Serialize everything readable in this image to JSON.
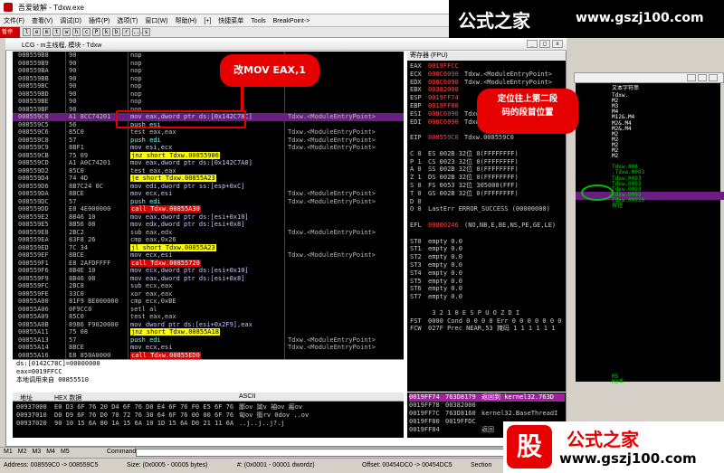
{
  "window": {
    "title": "吾爱破解 - Tdxw.exe"
  },
  "menu": [
    "文件(F)",
    "查看(V)",
    "调试(D)",
    "插件(P)",
    "选项(T)",
    "窗口(W)",
    "帮助(H)",
    "[+]",
    "快捷菜单",
    "Tools",
    "BreakPoint->"
  ],
  "toolbar": {
    "state": "暂停",
    "letters": [
      "l",
      "e",
      "m",
      "t",
      "w",
      "h",
      "c",
      "P",
      "k",
      "b",
      "r",
      "...",
      "s"
    ]
  },
  "brand": {
    "top_name": "公式之家",
    "top_url": "www.gszj100.com",
    "bottom_logo": "股",
    "bottom_name": "公式之家",
    "bottom_url": "www.gszj100.com"
  },
  "cpu": {
    "title": "LCG - m主线程, 模块 - Tdxw",
    "disasm": [
      {
        "addr": "008559B8",
        "hex": "90",
        "asm": "nop",
        "cmt": ""
      },
      {
        "addr": "008559B9",
        "hex": "90",
        "asm": "nop",
        "cmt": ""
      },
      {
        "addr": "008559BA",
        "hex": "90",
        "asm": "nop",
        "cmt": ""
      },
      {
        "addr": "008559BB",
        "hex": "90",
        "asm": "nop",
        "cmt": ""
      },
      {
        "addr": "008559BC",
        "hex": "90",
        "asm": "nop",
        "cmt": ""
      },
      {
        "addr": "008559BD",
        "hex": "90",
        "asm": "nop",
        "cmt": ""
      },
      {
        "addr": "008559BE",
        "hex": "90",
        "asm": "nop",
        "cmt": ""
      },
      {
        "addr": "008559BF",
        "hex": "90",
        "asm": "nop",
        "cmt": ""
      },
      {
        "addr": "008559C0",
        "hex": "A1 8CC74201",
        "asm": "mov eax,dword ptr ds:[0x142C78C]",
        "cmt": "Tdxw.<ModuleEntryPoint>"
      },
      {
        "addr": "008559C5",
        "hex": "56",
        "asm": "push esi",
        "cmt": ""
      },
      {
        "addr": "008559C6",
        "hex": "85C0",
        "asm": "test eax,eax",
        "cmt": "Tdxw.<ModuleEntryPoint>"
      },
      {
        "addr": "008559C8",
        "hex": "57",
        "asm": "push edi",
        "cmt": "Tdxw.<ModuleEntryPoint>"
      },
      {
        "addr": "008559C9",
        "hex": "8BF1",
        "asm": "mov esi,ecx",
        "cmt": "Tdxw.<ModuleEntryPoint>"
      },
      {
        "addr": "008559CB",
        "hex": "75 09",
        "asm": "jnz short Tdxw.00855906",
        "cmt": ""
      },
      {
        "addr": "008559CD",
        "hex": "A1 A0C74201",
        "asm": "mov eax,dword ptr ds:[0x142C7A0]",
        "cmt": ""
      },
      {
        "addr": "008559D2",
        "hex": "85C0",
        "asm": "test eax,eax",
        "cmt": ""
      },
      {
        "addr": "008559D4",
        "hex": "74 4D",
        "asm": "je short Tdxw.00855A23",
        "cmt": ""
      },
      {
        "addr": "008559D6",
        "hex": "8B7C24 0C",
        "asm": "mov edi,dword ptr ss:[esp+0xC]",
        "cmt": ""
      },
      {
        "addr": "008559DA",
        "hex": "8BCE",
        "asm": "mov ecx,esi",
        "cmt": "Tdxw.<ModuleEntryPoint>"
      },
      {
        "addr": "008559DC",
        "hex": "57",
        "asm": "push edi",
        "cmt": "Tdxw.<ModuleEntryPoint>"
      },
      {
        "addr": "008559DD",
        "hex": "E8 4E000000",
        "asm": "call Tdxw.00855A30",
        "cmt": ""
      },
      {
        "addr": "008559E2",
        "hex": "8B46 10",
        "asm": "mov eax,dword ptr ds:[esi+0x10]",
        "cmt": ""
      },
      {
        "addr": "008559E5",
        "hex": "8B56 08",
        "asm": "mov edx,dword ptr ds:[esi+0x8]",
        "cmt": ""
      },
      {
        "addr": "008559E8",
        "hex": "2BC2",
        "asm": "sub eax,edx",
        "cmt": "Tdxw.<ModuleEntryPoint>"
      },
      {
        "addr": "008559EA",
        "hex": "83F8 26",
        "asm": "cmp eax,0x26",
        "cmt": ""
      },
      {
        "addr": "008559ED",
        "hex": "7C 34",
        "asm": "jl short Tdxw.00855A23",
        "cmt": ""
      },
      {
        "addr": "008559EF",
        "hex": "8BCE",
        "asm": "mov ecx,esi",
        "cmt": "Tdxw.<ModuleEntryPoint>"
      },
      {
        "addr": "008559F1",
        "hex": "E8 2AFDFFFF",
        "asm": "call Tdxw.00855720",
        "cmt": ""
      },
      {
        "addr": "008559F6",
        "hex": "8B4E 10",
        "asm": "mov ecx,dword ptr ds:[esi+0x10]",
        "cmt": ""
      },
      {
        "addr": "008559F9",
        "hex": "8B46 08",
        "asm": "mov eax,dword ptr ds:[esi+0x8]",
        "cmt": ""
      },
      {
        "addr": "008559FC",
        "hex": "2BC8",
        "asm": "sub ecx,eax",
        "cmt": ""
      },
      {
        "addr": "008559FE",
        "hex": "33C0",
        "asm": "xor eax,eax",
        "cmt": ""
      },
      {
        "addr": "00855A00",
        "hex": "81F9 BE000000",
        "asm": "cmp ecx,0xBE",
        "cmt": ""
      },
      {
        "addr": "00855A06",
        "hex": "0F9CC0",
        "asm": "setl al",
        "cmt": ""
      },
      {
        "addr": "00855A09",
        "hex": "85C0",
        "asm": "test eax,eax",
        "cmt": ""
      },
      {
        "addr": "00855A0B",
        "hex": "8986 F9020000",
        "asm": "mov dword ptr ds:[esi+0x2F9],eax",
        "cmt": ""
      },
      {
        "addr": "00855A11",
        "hex": "75 08",
        "asm": "jnz short Tdxw.00855A18",
        "cmt": ""
      },
      {
        "addr": "00855A13",
        "hex": "57",
        "asm": "push edi",
        "cmt": "Tdxw.<ModuleEntryPoint>"
      },
      {
        "addr": "00855A14",
        "hex": "8BCE",
        "asm": "mov ecx,esi",
        "cmt": "Tdxw.<ModuleEntryPoint>"
      },
      {
        "addr": "00855A16",
        "hex": "E8 850A0000",
        "asm": "call Tdxw.00855ED0",
        "cmt": ""
      }
    ],
    "info": [
      "ds:[0142C78C]=00000000",
      "eax=0019FFCC",
      "本地调用来自 00855510"
    ],
    "dump": {
      "headers": [
        "地址",
        "HEX 数据",
        "ASCII"
      ],
      "rows": [
        {
          "addr": "00937000",
          "hex": "E0 D3 6F 76 20 D4 6F 76 D0 E4 6F 76 F0 E5 6F 76",
          "ascii": "鄙ov 詏v 袖ov 瘢ov"
        },
        {
          "addr": "00937010",
          "hex": "D0 D9 6F 76 D0 70 72 76 30 64 6F 76 00 00 6F 76",
          "ascii": "匈ov 衟rv 0dov ..ov"
        },
        {
          "addr": "00937020",
          "hex": "90 10 15 6A 80 1A 15 6A 10 1D 15 6A D0 21 11 6A",
          "ascii": "..j..j..j?.j"
        }
      ]
    }
  },
  "registers": {
    "title": "寄存器 (FPU)",
    "rows": [
      {
        "name": "EAX",
        "val": "0019FFCC",
        "note": ""
      },
      {
        "name": "ECX",
        "val": "008C6090",
        "note": "Tdxw.<ModuleEntryPoint>"
      },
      {
        "name": "EDX",
        "val": "008C6090",
        "note": "Tdxw.<ModuleEntryPoint>"
      },
      {
        "name": "EBX",
        "val": "00382000",
        "note": ""
      },
      {
        "name": "ESP",
        "val": "0019FF74",
        "note": ""
      },
      {
        "name": "EBP",
        "val": "0019FF80",
        "note": ""
      },
      {
        "name": "ESI",
        "val": "008C6090",
        "note": "Tdxw.<ModuleEntryPoint>"
      },
      {
        "name": "EDI",
        "val": "008C6090",
        "note": "Tdxw.<ModuleEntryPoint>"
      },
      {
        "name": "",
        "val": "",
        "note": ""
      },
      {
        "name": "EIP",
        "val": "008559C0",
        "note": "Tdxw.008559C0"
      },
      {
        "name": "",
        "val": "",
        "note": ""
      },
      {
        "name": "C 0",
        "val": "",
        "note": "ES 002B 32位 0(FFFFFFFF)"
      },
      {
        "name": "P 1",
        "val": "",
        "note": "CS 0023 32位 0(FFFFFFFF)"
      },
      {
        "name": "A 0",
        "val": "",
        "note": "SS 002B 32位 0(FFFFFFFF)"
      },
      {
        "name": "Z 1",
        "val": "",
        "note": "DS 002B 32位 0(FFFFFFFF)"
      },
      {
        "name": "S 0",
        "val": "",
        "note": "FS 0053 32位 305000(FFF)"
      },
      {
        "name": "T 0",
        "val": "",
        "note": "GS 002B 32位 0(FFFFFFFF)"
      },
      {
        "name": "D 0",
        "val": "",
        "note": ""
      },
      {
        "name": "O 0",
        "val": "",
        "note": "LastErr ERROR_SUCCESS (00000000)"
      },
      {
        "name": "",
        "val": "",
        "note": ""
      },
      {
        "name": "EFL",
        "val": "00000246",
        "note": "(NO,NB,E,BE,NS,PE,GE,LE)"
      },
      {
        "name": "",
        "val": "",
        "note": ""
      },
      {
        "name": "ST0",
        "val": "",
        "note": "empty 0.0"
      },
      {
        "name": "ST1",
        "val": "",
        "note": "empty 0.0"
      },
      {
        "name": "ST2",
        "val": "",
        "note": "empty 0.0"
      },
      {
        "name": "ST3",
        "val": "",
        "note": "empty 0.0"
      },
      {
        "name": "ST4",
        "val": "",
        "note": "empty 0.0"
      },
      {
        "name": "ST5",
        "val": "",
        "note": "empty 0.0"
      },
      {
        "name": "ST6",
        "val": "",
        "note": "empty 0.0"
      },
      {
        "name": "ST7",
        "val": "",
        "note": "empty 0.0"
      },
      {
        "name": "",
        "val": "",
        "note": ""
      },
      {
        "name": "",
        "val": "",
        "note": "               3 2 1 0     E S P U O Z D I"
      },
      {
        "name": "FST",
        "val": "",
        "note": "0000  Cond 0 0 0 0  Err 0 0 0 0 0 0 0 0"
      },
      {
        "name": "FCW",
        "val": "",
        "note": "027F  Prec NEAR,53  掩码  1 1 1 1 1 1"
      }
    ]
  },
  "stack": [
    {
      "addr": "0019FF74",
      "val": "763D8179",
      "cmt": "返回到 kernel32.763D"
    },
    {
      "addr": "0019FF78",
      "val": "00382000",
      "cmt": ""
    },
    {
      "addr": "0019FF7C",
      "val": "763D8160",
      "cmt": "kernel32.BaseThreadI"
    },
    {
      "addr": "0019FF80",
      "val": "0019FFDC",
      "cmt": ""
    },
    {
      "addr": "0019FF84",
      "val": "",
      "cmt": "返回"
    }
  ],
  "strings": {
    "title": "文本字符串",
    "items": [
      "Tdxw.",
      "M2",
      "M3",
      "M4",
      "M12&.M4",
      "M2&.M4",
      "M2&.M4",
      "M2",
      "M2",
      "M2",
      "M2",
      "M2",
      "",
      "Tdxw.008",
      ".Tdxw.0093",
      "Tdxw.0093",
      "Tdxw.0093",
      "Tdxw.0093",
      "Tdxw.0093",
      "Tdxw.00930",
      "按钮",
      "",
      "",
      "",
      "",
      "",
      "",
      "",
      "",
      "",
      "",
      "",
      "",
      "",
      "",
      "",
      "",
      "",
      "",
      "",
      "",
      "",
      "",
      "",
      "",
      "",
      "",
      "",
      "",
      "",
      "",
      "M5",
      "M3手",
      "M3手"
    ]
  },
  "command": {
    "tabs": [
      "M1",
      "M2",
      "M3",
      "M4",
      "M5"
    ],
    "label": "Command:"
  },
  "status": {
    "addr": "Address: 008559C0 -> 008559C5",
    "size": "Size: (0x0005 - 00005 bytes)",
    "value": "#: (0x0001 - 00001 dwordz)",
    "offset": "Offset: 00454DC0 -> 00454DC5",
    "section": "Section"
  },
  "annotations": {
    "bubble1": "改MOV EAX,1",
    "bubble2_line1": "定位往上第二段",
    "bubble2_line2": "码的段首位置"
  }
}
